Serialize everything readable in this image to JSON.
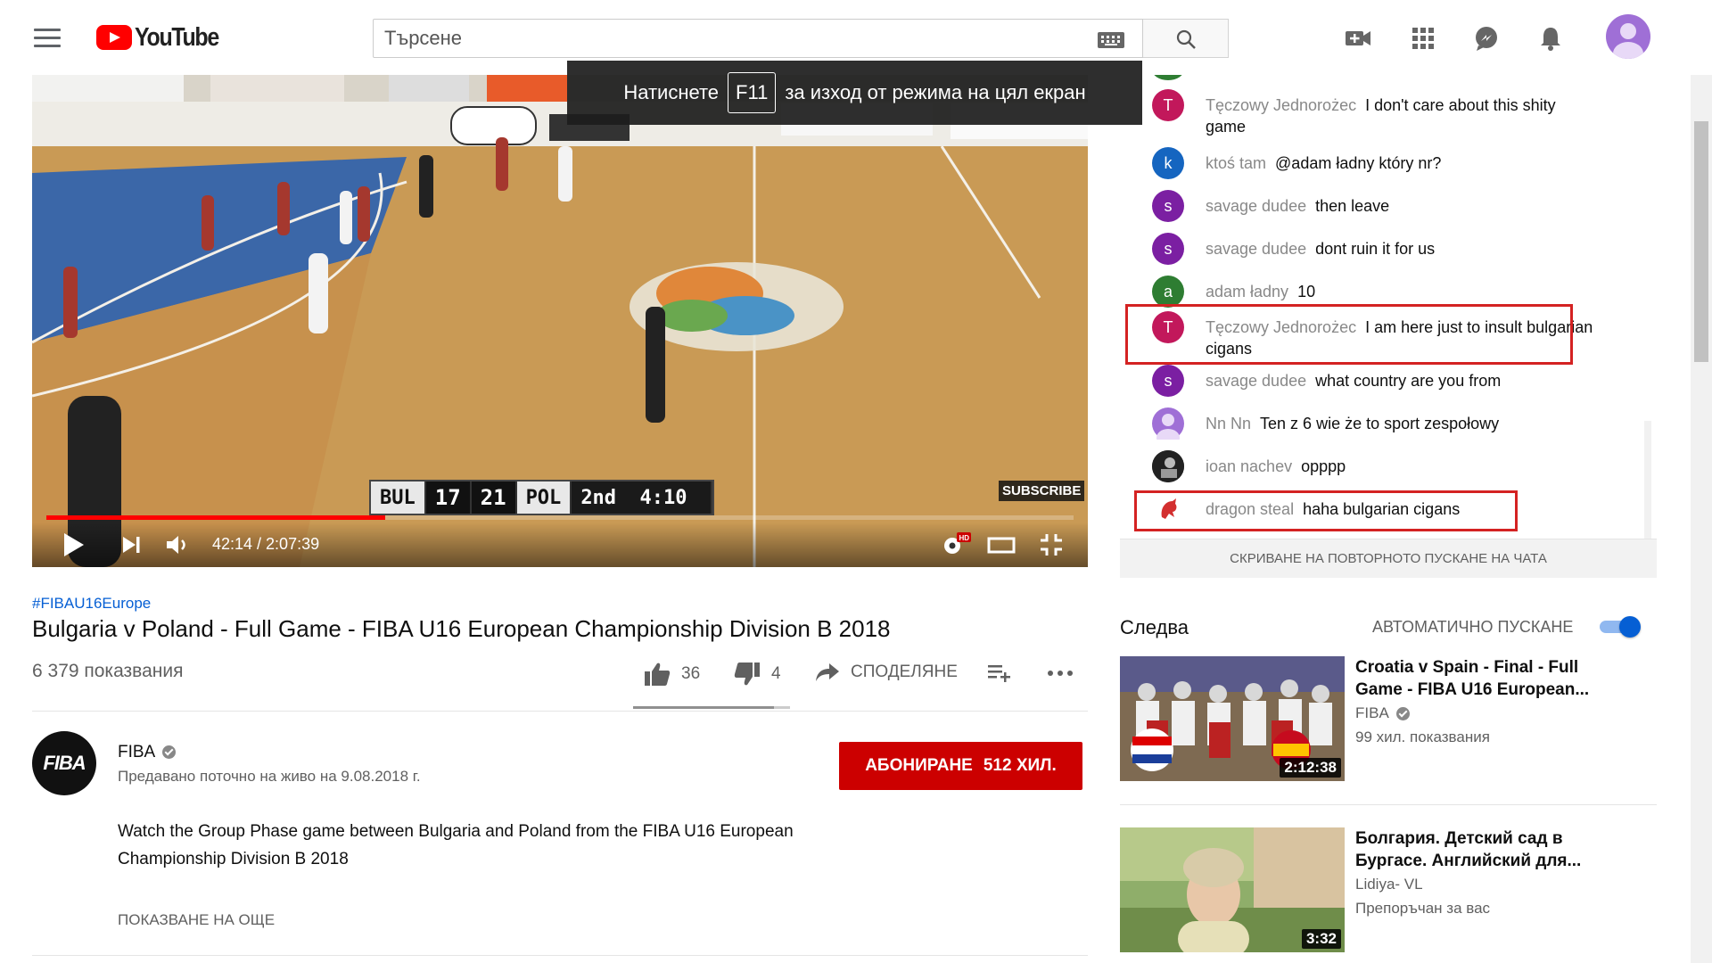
{
  "header": {
    "logo_text": "YouTube",
    "search_placeholder": "Търсене"
  },
  "player": {
    "fullscreen_notice_before": "Натиснете",
    "fullscreen_notice_key": "F11",
    "fullscreen_notice_after": "за изход от режима на цял екран",
    "time_display": "42:14 / 2:07:39",
    "progress_fraction": 0.33,
    "subscribe_watermark": "SUBSCRIBE",
    "hd_badge": "HD",
    "scoreboard": {
      "team1": "BUL",
      "score1": "17",
      "score2": "21",
      "team2": "POL",
      "period_clock": "2nd  4:10"
    }
  },
  "video": {
    "hashtag": "#FIBAU16Europe",
    "title": "Bulgaria v Poland - Full Game - FIBA U16 European Championship Division B 2018",
    "views": "6 379 показвания",
    "likes": "36",
    "dislikes": "4",
    "share_label": "СПОДЕЛЯНЕ",
    "like_ratio": 0.9
  },
  "channel": {
    "avatar_text": "FIBA",
    "name": "FIBA",
    "stream_date": "Предавано поточно на живо на 9.08.2018 г.",
    "subscribe_label": "АБОНИРАНЕ",
    "subscriber_count": "512 ХИЛ.",
    "description": "Watch the Group Phase game between Bulgaria and Poland from the FIBA U16 European Championship Division B 2018",
    "show_more": "ПОКАЗВАНЕ НА ОЩЕ"
  },
  "chat": {
    "messages": [
      {
        "author": "Tęczowy Jednorożec",
        "text": "I don't care about this shity game",
        "initial": "T",
        "color": "#c2185b"
      },
      {
        "author": "ktoś tam",
        "text": "@adam ładny który nr?",
        "initial": "k",
        "color": "#1565c0"
      },
      {
        "author": "savage dudee",
        "text": "then leave",
        "initial": "s",
        "color": "#7b1fa2"
      },
      {
        "author": "savage dudee",
        "text": "dont ruin it for us",
        "initial": "s",
        "color": "#7b1fa2"
      },
      {
        "author": "adam ładny",
        "text": "10",
        "initial": "a",
        "color": "#2e7d32"
      },
      {
        "author": "Tęczowy Jednorożec",
        "text": "I am here just to insult bulgarian cigans",
        "initial": "T",
        "color": "#c2185b"
      },
      {
        "author": "savage dudee",
        "text": "what country are you from",
        "initial": "s",
        "color": "#7b1fa2"
      },
      {
        "author": "Nn Nn",
        "text": "Ten z 6 wie że to sport zespołowy",
        "initial": "",
        "color": "#9f6fd6"
      },
      {
        "author": "ioan nachev",
        "text": "opppp",
        "initial": "",
        "color": "#222222"
      },
      {
        "author": "dragon steal",
        "text": "haha bulgarian cigans",
        "initial": "",
        "color": "#ffffff"
      }
    ],
    "hide_replay_label": "СКРИВАНЕ НА ПОВТОРНОТО ПУСКАНЕ НА ЧАТА"
  },
  "up_next": {
    "label": "Следва",
    "autoplay_label": "АВТОМАТИЧНО ПУСКАНЕ",
    "autoplay_on": true,
    "items": [
      {
        "title": "Croatia v Spain - Final - Full Game - FIBA U16 European...",
        "channel": "FIBA",
        "meta": "99 хил. показвания",
        "duration": "2:12:38",
        "verified": true
      },
      {
        "title": "Болгария. Детский сад в Бургасе. Английский для...",
        "channel": "Lidiya- VL",
        "meta": "Препоръчан за вас",
        "duration": "3:32",
        "verified": false
      }
    ]
  },
  "colors": {
    "accent_red": "#ff0000",
    "subscribe_red": "#cc0000",
    "link_blue": "#065fd4",
    "highlight_box": "#d42222"
  }
}
